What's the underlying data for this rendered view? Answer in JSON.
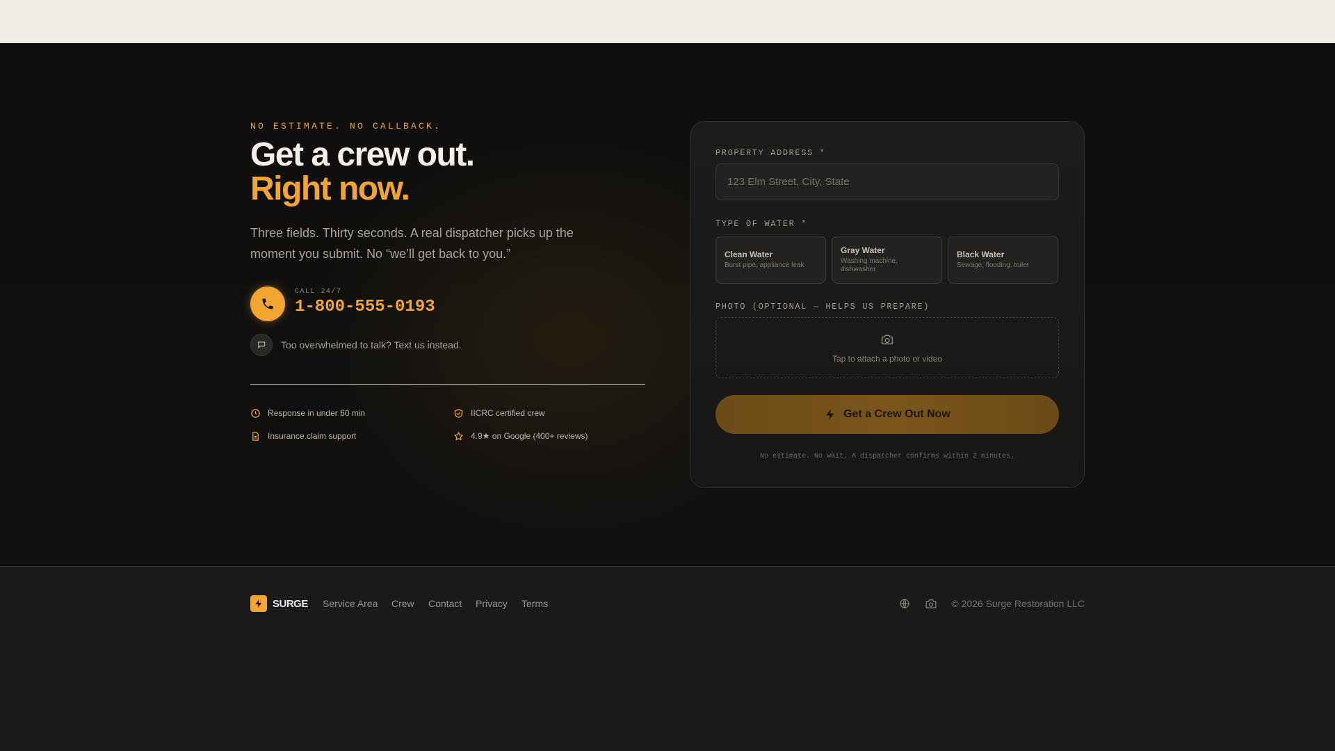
{
  "hero": {
    "eyebrow": "NO ESTIMATE. NO CALLBACK.",
    "headline_line1": "Get a crew out.",
    "headline_line2": "Right now.",
    "subtext": "Three fields. Thirty seconds. A real dispatcher picks up the moment you submit. No “we’ll get back to you.”",
    "call_label": "CALL 24/7",
    "phone": "1-800-555-0193",
    "text_us": "Too overwhelmed to talk? Text us instead.",
    "features": [
      {
        "label": "Response in under 60 min",
        "icon": "clock-icon"
      },
      {
        "label": "IICRC certified crew",
        "icon": "shield-check-icon"
      },
      {
        "label": "Insurance claim support",
        "icon": "document-icon"
      },
      {
        "label": "4.9★ on Google (400+ reviews)",
        "icon": "star-icon"
      }
    ]
  },
  "form": {
    "address_label": "PROPERTY ADDRESS *",
    "address_placeholder": "123 Elm Street, City, State",
    "address_value": "",
    "water_label": "TYPE OF WATER *",
    "water_options": [
      {
        "title": "Clean Water",
        "desc": "Burst pipe, appliance leak"
      },
      {
        "title": "Gray Water",
        "desc": "Washing machine, dishwasher"
      },
      {
        "title": "Black Water",
        "desc": "Sewage, flooding, toilet"
      }
    ],
    "photo_label": "PHOTO (OPTIONAL — HELPS US PREPARE)",
    "photo_hint": "Tap to attach a photo or video",
    "submit_label": "Get a Crew Out Now",
    "note": "No estimate. No wait. A dispatcher confirms within 2 minutes."
  },
  "footer": {
    "brand": "SURGE",
    "links": [
      "Service Area",
      "Crew",
      "Contact",
      "Privacy",
      "Terms"
    ],
    "social_icons": [
      "globe-icon",
      "camera-icon"
    ],
    "copyright": "© 2026 Surge Restoration LLC"
  },
  "colors": {
    "accent": "#f3a531",
    "background": "#121110",
    "topbar": "#f0ebe4"
  }
}
